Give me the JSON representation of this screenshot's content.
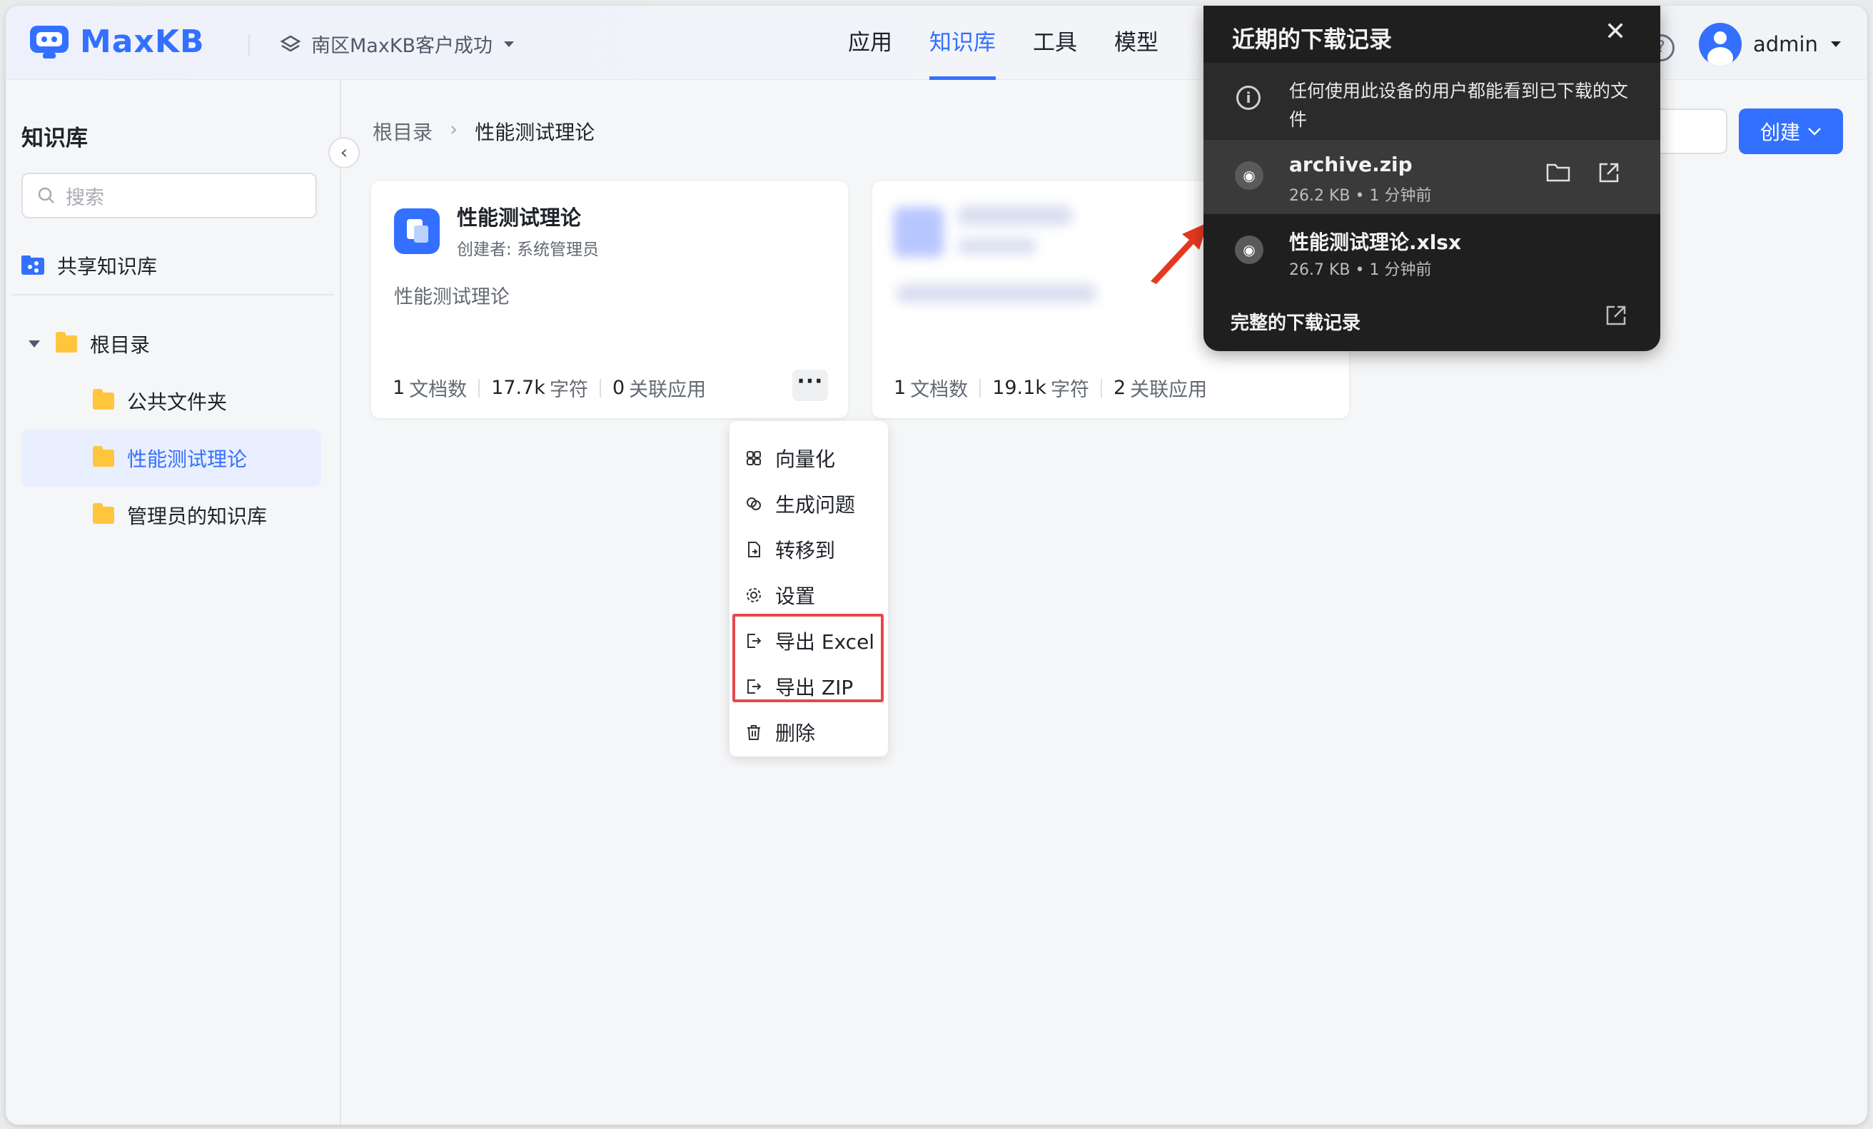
{
  "header": {
    "brand": "MaxKB",
    "workspace": "南区MaxKB客户成功",
    "nav": [
      "应用",
      "知识库",
      "工具",
      "模型"
    ],
    "active_nav": "知识库",
    "help_glyph": "?",
    "user": "admin"
  },
  "sidebar": {
    "title": "知识库",
    "search_placeholder": "搜索",
    "shared": "共享知识库",
    "root": "根目录",
    "folders": [
      "公共文件夹",
      "性能测试理论",
      "管理员的知识库"
    ],
    "active_folder": "性能测试理论"
  },
  "main": {
    "breadcrumb": [
      "根目录",
      "性能测试理论"
    ],
    "create_label": "创建",
    "cards": [
      {
        "title": "性能测试理论",
        "creator": "创建者: 系统管理员",
        "desc": "性能测试理论",
        "docs_num": "1",
        "docs_label": "文档数",
        "chars_num": "17.7k",
        "chars_label": "字符",
        "apps_num": "0",
        "apps_label": "关联应用"
      },
      {
        "docs_num": "1",
        "docs_label": "文档数",
        "chars_num": "19.1k",
        "chars_label": "字符",
        "apps_num": "2",
        "apps_label": "关联应用"
      }
    ]
  },
  "menu": {
    "items": [
      {
        "label": "向量化",
        "icon": "vectorize-icon"
      },
      {
        "label": "生成问题",
        "icon": "generate-icon"
      },
      {
        "label": "转移到",
        "icon": "move-icon"
      },
      {
        "label": "设置",
        "icon": "gear-icon"
      },
      {
        "label": "导出 Excel",
        "icon": "export-icon"
      },
      {
        "label": "导出 ZIP",
        "icon": "export-icon"
      },
      {
        "label": "删除",
        "icon": "trash-icon"
      }
    ],
    "highlight_color": "#e5484d"
  },
  "downloads": {
    "title": "近期的下载记录",
    "notice": "任何使用此设备的用户都能看到已下载的文件",
    "items": [
      {
        "name": "archive.zip",
        "meta": "26.2 KB • 1 分钟前"
      },
      {
        "name": "性能测试理论.xlsx",
        "meta": "26.7 KB • 1 分钟前"
      }
    ],
    "footer": "完整的下载记录"
  },
  "colors": {
    "accent": "#3370ff",
    "popup_bg": "#1f1f1f",
    "arrow": "#e5391f"
  }
}
